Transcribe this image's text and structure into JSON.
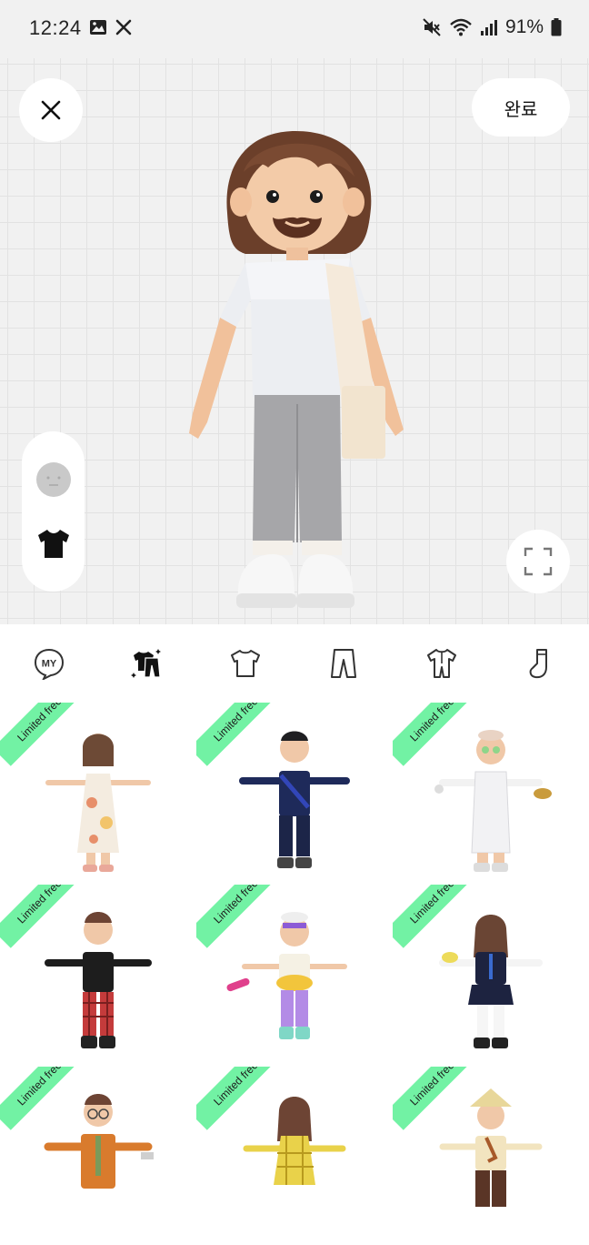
{
  "status_bar": {
    "time": "12:24",
    "battery": "91%",
    "icons": [
      "gallery-icon",
      "tools-icon",
      "mute-icon",
      "wifi-icon",
      "signal-icon",
      "battery-icon"
    ]
  },
  "editor": {
    "close_icon": "close-icon",
    "done_label": "완료",
    "side_tools": [
      "face-icon",
      "tshirt-icon"
    ],
    "fullscreen_icon": "fullscreen-icon"
  },
  "categories": [
    "my-icon",
    "outfit-set-icon",
    "top-icon",
    "pants-icon",
    "onepiece-icon",
    "socks-icon"
  ],
  "selected_category": "outfit-set-icon",
  "outfits": [
    {
      "badge": "Limited free trial",
      "style": "floral-dress"
    },
    {
      "badge": "Limited free trial",
      "style": "navy-tracksuit"
    },
    {
      "badge": "Limited free trial",
      "style": "white-bathrobe"
    },
    {
      "badge": "Limited free trial",
      "style": "red-plaid-punk"
    },
    {
      "badge": "Limited free trial",
      "style": "summer-floatie"
    },
    {
      "badge": "Limited free trial",
      "style": "school-uniform"
    },
    {
      "badge": "Limited free trial",
      "style": "orange-suit"
    },
    {
      "badge": "Limited free trial",
      "style": "yellow-plaid-dress"
    },
    {
      "badge": "Limited free trial",
      "style": "straw-hat-farmer"
    }
  ],
  "colors": {
    "badge": "#72f2a4",
    "stage_bg": "#f1f1f1",
    "grid_line": "#e2e2e2"
  }
}
